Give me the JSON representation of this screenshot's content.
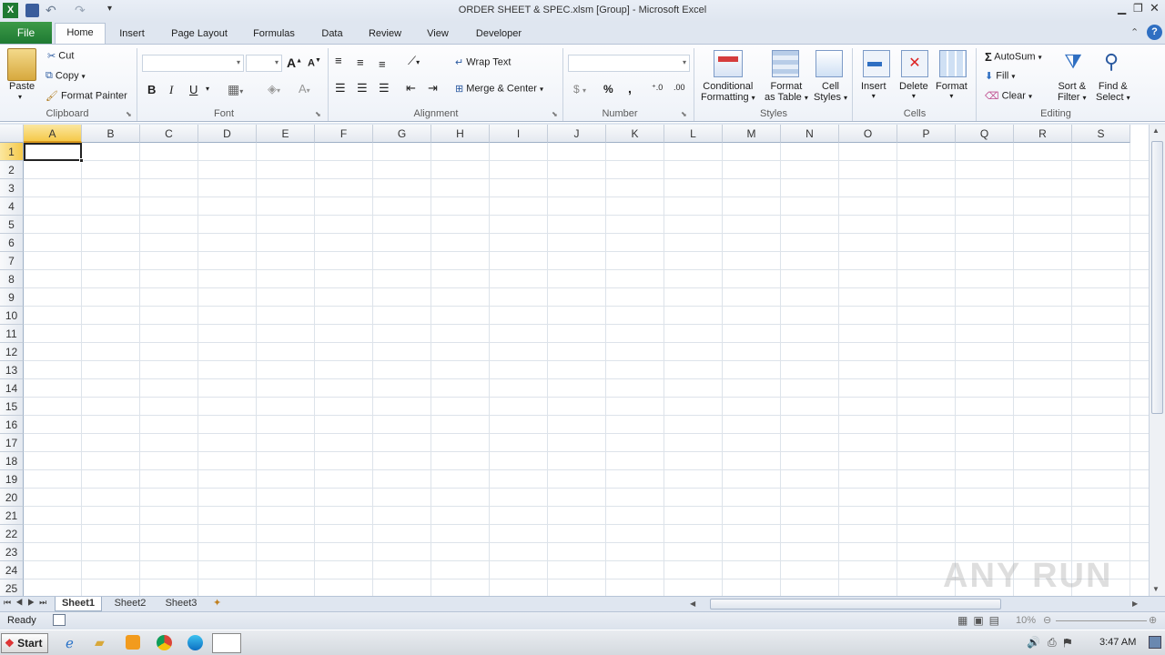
{
  "window": {
    "title": "ORDER SHEET & SPEC.xlsm  [Group]  -  Microsoft Excel"
  },
  "tabs": [
    "File",
    "Home",
    "Insert",
    "Page Layout",
    "Formulas",
    "Data",
    "Review",
    "View",
    "Developer"
  ],
  "clipboard": {
    "paste": "Paste",
    "cut": "Cut",
    "copy": "Copy",
    "format_painter": "Format Painter",
    "label": "Clipboard"
  },
  "font": {
    "label": "Font",
    "bold": "B",
    "italic": "I",
    "underline": "U"
  },
  "alignment": {
    "wrap": "Wrap Text",
    "merge": "Merge & Center",
    "label": "Alignment"
  },
  "number": {
    "label": "Number",
    "currency": "$",
    "percent": "%",
    "comma": ","
  },
  "styles": {
    "conditional": "Conditional",
    "conditional2": "Formatting",
    "format_table": "Format",
    "format_table2": "as Table",
    "cell_styles": "Cell",
    "cell_styles2": "Styles",
    "label": "Styles"
  },
  "cells": {
    "insert": "Insert",
    "delete": "Delete",
    "format": "Format",
    "label": "Cells"
  },
  "editing": {
    "autosum": "AutoSum",
    "fill": "Fill",
    "clear": "Clear",
    "sort": "Sort &",
    "sort2": "Filter",
    "find": "Find &",
    "find2": "Select",
    "label": "Editing"
  },
  "columns": [
    "A",
    "B",
    "C",
    "D",
    "E",
    "F",
    "G",
    "H",
    "I",
    "J",
    "K",
    "L",
    "M",
    "N",
    "O",
    "P",
    "Q",
    "R",
    "S"
  ],
  "rows": [
    "1",
    "2",
    "3",
    "4",
    "5",
    "6",
    "7",
    "8",
    "9",
    "10",
    "11",
    "12",
    "13",
    "14",
    "15",
    "16",
    "17",
    "18",
    "19",
    "20",
    "21",
    "22",
    "23",
    "24",
    "25"
  ],
  "sheets": [
    "Sheet1",
    "Sheet2",
    "Sheet3"
  ],
  "status": {
    "ready": "Ready",
    "zoom": "10%"
  },
  "taskbar": {
    "start": "Start",
    "time": "3:47 AM"
  },
  "watermark": "ANY RUN"
}
